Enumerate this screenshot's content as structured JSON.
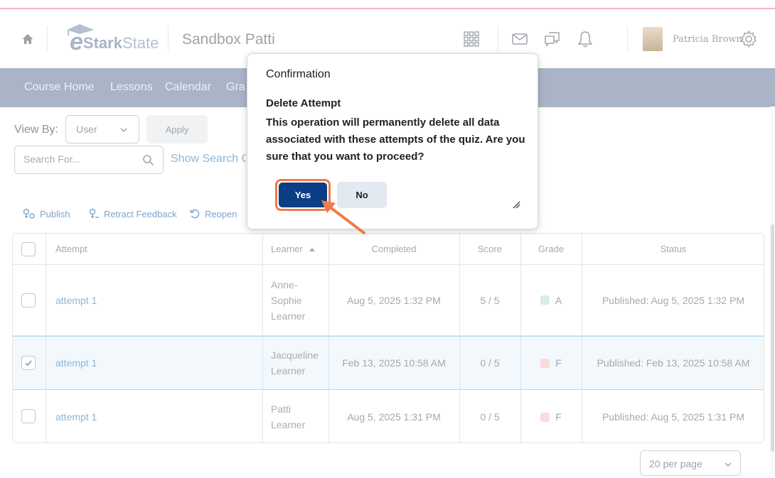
{
  "header": {
    "logo": {
      "e": "e",
      "stark": "Stark",
      "state": "State"
    },
    "course_title": "Sandbox Patti",
    "user_name": "Patricia Brown",
    "icons": [
      "home-icon",
      "apps-grid-icon",
      "mail-icon",
      "chat-icon",
      "bell-icon",
      "gear-icon"
    ]
  },
  "nav": {
    "items": [
      "Course Home",
      "Lessons",
      "Calendar",
      "Gra"
    ]
  },
  "filters": {
    "view_by_label": "View By:",
    "view_by_value": "User",
    "apply_label": "Apply",
    "search_placeholder": "Search For...",
    "show_search_options": "Show Search Options"
  },
  "actions": {
    "publish": "Publish",
    "retract_feedback": "Retract Feedback",
    "reopen": "Reopen"
  },
  "table": {
    "headers": {
      "attempt": "Attempt",
      "learner": "Learner",
      "completed": "Completed",
      "score": "Score",
      "grade": "Grade",
      "status": "Status"
    },
    "rows": [
      {
        "attempt": "attempt 1",
        "learner_line1": "Anne-",
        "learner_line2": "Sophie",
        "learner_line3": "Learner",
        "completed": "Aug 5, 2025 1:32 PM",
        "score": "5 / 5",
        "grade": "A",
        "grade_color": "#d8eedf",
        "status": "Published: Aug 5, 2025 1:32 PM",
        "checked": false
      },
      {
        "attempt": "attempt 1",
        "learner_line1": "Jacqueline",
        "learner_line2": "Learner",
        "completed": "Feb 13, 2025 10:58 AM",
        "score": "0 / 5",
        "grade": "F",
        "grade_color": "#fbd9dd",
        "status": "Published: Feb 13, 2025 10:58 AM",
        "checked": true
      },
      {
        "attempt": "attempt 1",
        "learner_line1": "Patti",
        "learner_line2": "Learner",
        "completed": "Aug 5, 2025 1:31 PM",
        "score": "0 / 5",
        "grade": "F",
        "grade_color": "#fbd9dd",
        "status": "Published: Aug 5, 2025 1:31 PM",
        "checked": false
      }
    ]
  },
  "pagination": {
    "per_page": "20 per page"
  },
  "dialog": {
    "title": "Confirmation",
    "heading": "Delete Attempt",
    "message": "This operation will permanently delete all data associated with these attempts of the quiz. Are you sure that you want to proceed?",
    "yes_label": "Yes",
    "no_label": "No"
  },
  "colors": {
    "primary_button": "#0b3e85",
    "highlight_annotation": "#f07a4a",
    "navbar": "#a9b4c6",
    "link": "#8bb6d8",
    "pink_accent": "#f3b8c9"
  }
}
